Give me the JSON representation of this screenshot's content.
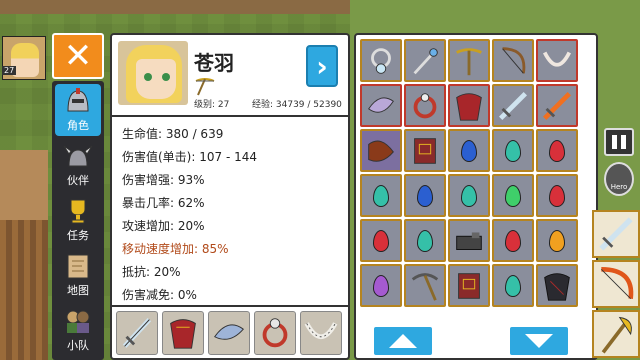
{
  "player": {
    "level": "27"
  },
  "nav": {
    "close_label": "✕",
    "items": [
      {
        "label": "角色",
        "icon": "helmet-icon"
      },
      {
        "label": "伙伴",
        "icon": "horned-helmet-icon"
      },
      {
        "label": "任务",
        "icon": "trophy-icon"
      },
      {
        "label": "地图",
        "icon": "map-scroll-icon"
      },
      {
        "label": "小队",
        "icon": "party-icon"
      }
    ]
  },
  "character": {
    "name": "苍羽",
    "level_text": "级别: 27",
    "exp_text": "经验: 34739 / 52390",
    "next_label": "›"
  },
  "stats": [
    {
      "text": "生命值: 380 / 639"
    },
    {
      "text": "伤害值(单击): 107 - 144"
    },
    {
      "text": "伤害增强: 93%"
    },
    {
      "text": "暴击几率: 62%"
    },
    {
      "text": "攻速增加: 20%"
    },
    {
      "text": "移动速度增加: 85%"
    },
    {
      "text": "抵抗: 20%"
    },
    {
      "text": "伤害减免: 0%"
    }
  ],
  "equipment": [
    "sword-icon",
    "red-armor-icon",
    "feather-charm-icon",
    "ring-icon",
    "necklace-icon"
  ],
  "inventory": [
    "amulet-icon",
    "staff-icon",
    "crossbow-icon",
    "bow-icon",
    "necklace-icon",
    "feather-charm-icon",
    "ring-icon",
    "red-armor-icon",
    "sword-icon",
    "flame-sword-icon",
    "dragon-bow-icon",
    "spellbook-icon",
    "blue-gem-icon",
    "teal-gem-icon",
    "red-gem-icon",
    "teal-gem-icon",
    "blue-gem-icon",
    "teal-gem-icon",
    "green-gem-icon",
    "red-gem-icon",
    "red-gem-icon",
    "teal-gem-icon",
    "gauntlet-icon",
    "red-gem-icon",
    "orange-gem-icon",
    "purple-gem-icon",
    "pickaxe-icon",
    "spellbook-icon",
    "teal-gem-icon",
    "dark-armor-icon"
  ],
  "colors": {
    "accent": "#2ea8e0",
    "close": "#f28c1c",
    "slot_border": "#b58420",
    "highlight_stat": "#b14a1a"
  },
  "hud": {
    "hero_label": "Hero"
  }
}
